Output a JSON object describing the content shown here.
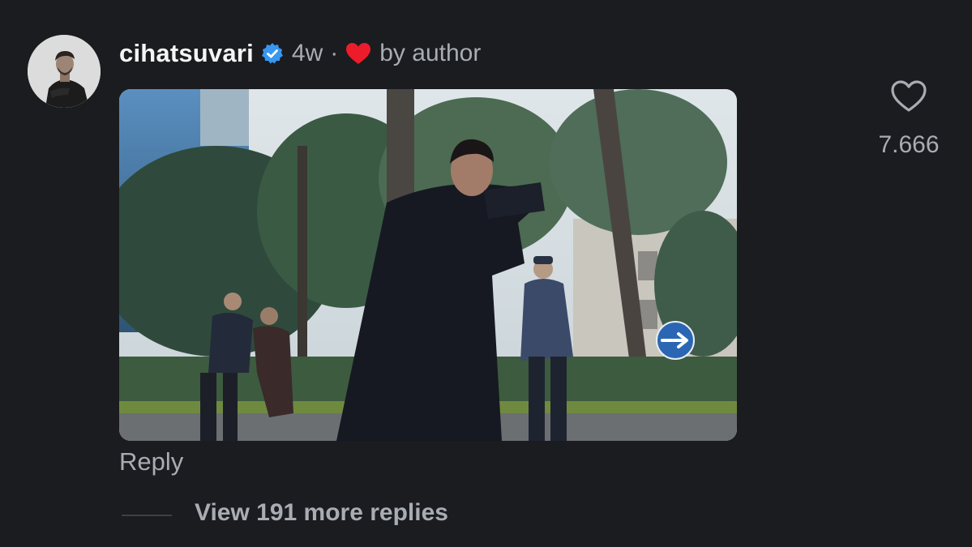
{
  "comment": {
    "username": "cihatsuvari",
    "verified": true,
    "time_ago": "4w",
    "separator": "·",
    "liked_by_author_label": "by author",
    "reply_label": "Reply",
    "view_replies_label": "View 191 more replies"
  },
  "likes": {
    "count": "7.666",
    "icon": "heart-outline-icon"
  },
  "icons": {
    "verified": "verified-badge-icon",
    "author_like": "red-heart-icon"
  },
  "colors": {
    "background": "#1a1c1f",
    "username": "#f5f5f5",
    "secondary_text": "#a8acb3",
    "verified_blue": "#3897f0",
    "heart_red": "#ed1c2b"
  }
}
